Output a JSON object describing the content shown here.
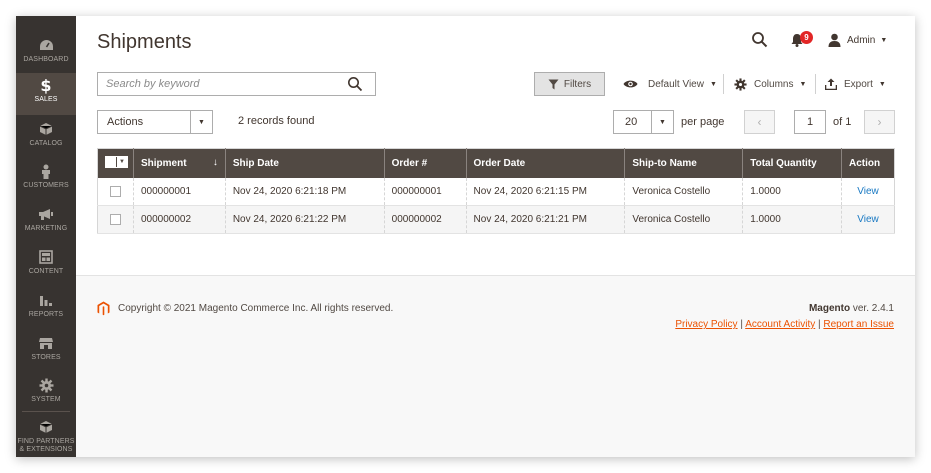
{
  "sidebar": {
    "items": [
      {
        "label": "DASHBOARD",
        "icon": "dashboard-icon"
      },
      {
        "label": "SALES",
        "icon": "dollar-icon"
      },
      {
        "label": "CATALOG",
        "icon": "cube-icon"
      },
      {
        "label": "CUSTOMERS",
        "icon": "person-icon"
      },
      {
        "label": "MARKETING",
        "icon": "megaphone-icon"
      },
      {
        "label": "CONTENT",
        "icon": "layout-icon"
      },
      {
        "label": "REPORTS",
        "icon": "bar-chart-icon"
      },
      {
        "label": "STORES",
        "icon": "store-icon"
      },
      {
        "label": "SYSTEM",
        "icon": "gear-icon"
      },
      {
        "label": "FIND PARTNERS & EXTENSIONS",
        "icon": "box-icon"
      }
    ],
    "active": "SALES"
  },
  "header": {
    "title": "Shipments",
    "notifications_count": "9",
    "user": "Admin"
  },
  "toolbar": {
    "search_placeholder": "Search by keyword",
    "filters_label": "Filters",
    "view_label": "Default View",
    "columns_label": "Columns",
    "export_label": "Export"
  },
  "actions": {
    "select_label": "Actions",
    "records_found": "2 records found",
    "per_page_value": "20",
    "per_page_label": "per page",
    "current_page": "1",
    "of_pages": "of 1"
  },
  "grid": {
    "columns": [
      "Shipment",
      "Ship Date",
      "Order #",
      "Order Date",
      "Ship-to Name",
      "Total Quantity",
      "Action"
    ],
    "rows": [
      {
        "shipment": "000000001",
        "ship_date": "Nov 24, 2020 6:21:18 PM",
        "order": "000000001",
        "order_date": "Nov 24, 2020 6:21:15 PM",
        "ship_to": "Veronica Costello",
        "qty": "1.0000",
        "action": "View"
      },
      {
        "shipment": "000000002",
        "ship_date": "Nov 24, 2020 6:21:22 PM",
        "order": "000000002",
        "order_date": "Nov 24, 2020 6:21:21 PM",
        "ship_to": "Veronica Costello",
        "qty": "1.0000",
        "action": "View"
      }
    ]
  },
  "footer": {
    "copyright": "Copyright © 2021 Magento Commerce Inc. All rights reserved.",
    "brand": "Magento",
    "version": "ver. 2.4.1",
    "privacy": "Privacy Policy",
    "activity": "Account Activity",
    "report": "Report an Issue",
    "separator": "|"
  },
  "colors": {
    "sidebar_bg": "#373330",
    "header_row_bg": "#514943",
    "link": "#1979c3",
    "footer_link": "#eb5202",
    "badge": "#e22626"
  }
}
